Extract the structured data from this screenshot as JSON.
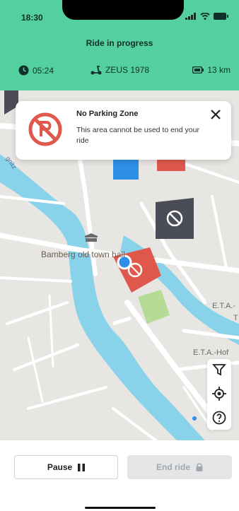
{
  "status_bar": {
    "time": "18:30"
  },
  "header": {
    "title": "Ride in progress",
    "ride_time": "05:24",
    "vehicle": "ZEUS 1978",
    "distance": "13 km"
  },
  "notification": {
    "title": "No Parking Zone",
    "message": "This area cannot be used to end your ride"
  },
  "map": {
    "labels": {
      "town_hall": "Bamberg old town hall",
      "street_1": "E.T.A.-",
      "street_1b": "T",
      "street_2": "E.T.A.-Hof",
      "street_3": "gnitz"
    }
  },
  "controls": {
    "pause_label": "Pause",
    "end_ride_label": "End ride"
  },
  "colors": {
    "header": "#54cfa0",
    "no_parking": "#e0584c",
    "water": "#89d3ea",
    "park": "#b5dc95"
  }
}
